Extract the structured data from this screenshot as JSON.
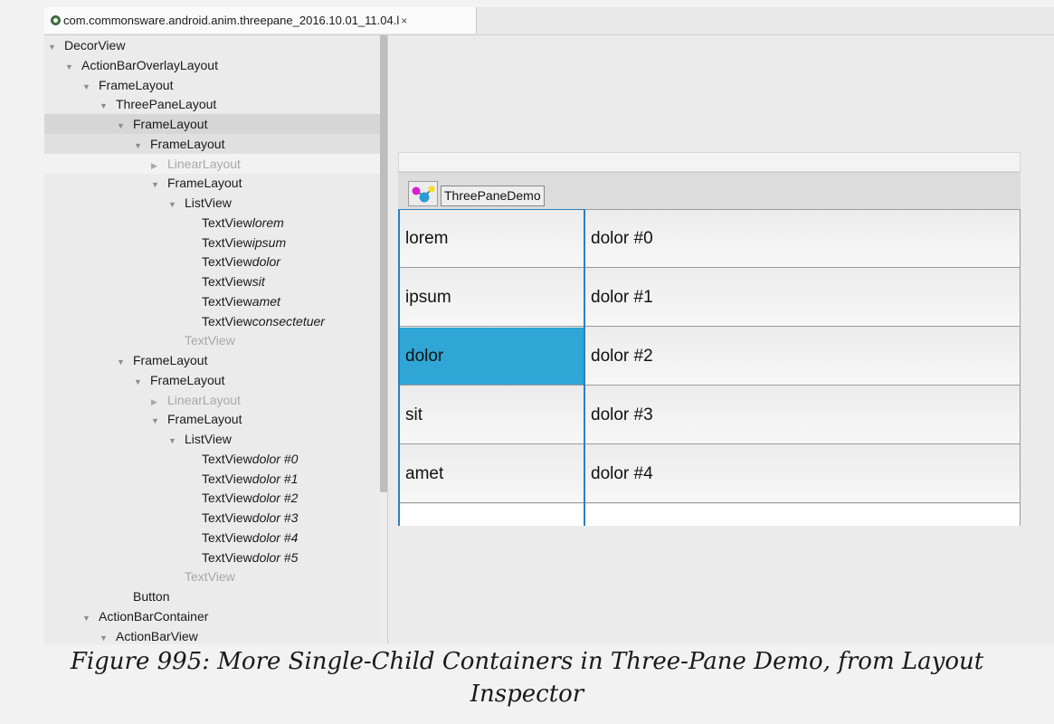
{
  "tab": {
    "title": "com.commonsware.android.anim.threepane_2016.10.01_11.04.l",
    "close": "×"
  },
  "tree": [
    {
      "label": "DecorView",
      "suffix": "",
      "depth": 0,
      "arrow": "expanded",
      "state": "normal"
    },
    {
      "label": "ActionBarOverlayLayout",
      "suffix": "",
      "depth": 1,
      "arrow": "expanded",
      "state": "normal"
    },
    {
      "label": "FrameLayout",
      "suffix": "",
      "depth": 2,
      "arrow": "expanded",
      "state": "normal"
    },
    {
      "label": "ThreePaneLayout",
      "suffix": "",
      "depth": 3,
      "arrow": "expanded",
      "state": "normal"
    },
    {
      "label": "FrameLayout",
      "suffix": "",
      "depth": 4,
      "arrow": "expanded",
      "state": "selected"
    },
    {
      "label": "FrameLayout",
      "suffix": "",
      "depth": 5,
      "arrow": "expanded",
      "state": "hover"
    },
    {
      "label": "LinearLayout",
      "suffix": "",
      "depth": 6,
      "arrow": "collapsed",
      "state": "dim-light"
    },
    {
      "label": "FrameLayout",
      "suffix": "",
      "depth": 6,
      "arrow": "expanded",
      "state": "normal"
    },
    {
      "label": "ListView",
      "suffix": "",
      "depth": 7,
      "arrow": "expanded",
      "state": "normal"
    },
    {
      "label": "TextView",
      "suffix": "lorem",
      "depth": 8,
      "arrow": "none",
      "state": "normal"
    },
    {
      "label": "TextView",
      "suffix": "ipsum",
      "depth": 8,
      "arrow": "none",
      "state": "normal"
    },
    {
      "label": "TextView",
      "suffix": "dolor",
      "depth": 8,
      "arrow": "none",
      "state": "normal"
    },
    {
      "label": "TextView",
      "suffix": "sit",
      "depth": 8,
      "arrow": "none",
      "state": "normal"
    },
    {
      "label": "TextView",
      "suffix": "amet",
      "depth": 8,
      "arrow": "none",
      "state": "normal"
    },
    {
      "label": "TextView",
      "suffix": "consectetuer",
      "depth": 8,
      "arrow": "none",
      "state": "normal"
    },
    {
      "label": "TextView",
      "suffix": "",
      "depth": 7,
      "arrow": "none",
      "state": "dim"
    },
    {
      "label": "FrameLayout",
      "suffix": "",
      "depth": 4,
      "arrow": "expanded",
      "state": "normal"
    },
    {
      "label": "FrameLayout",
      "suffix": "",
      "depth": 5,
      "arrow": "expanded",
      "state": "normal"
    },
    {
      "label": "LinearLayout",
      "suffix": "",
      "depth": 6,
      "arrow": "collapsed",
      "state": "dim"
    },
    {
      "label": "FrameLayout",
      "suffix": "",
      "depth": 6,
      "arrow": "expanded",
      "state": "normal"
    },
    {
      "label": "ListView",
      "suffix": "",
      "depth": 7,
      "arrow": "expanded",
      "state": "normal"
    },
    {
      "label": "TextView",
      "suffix": "dolor #0",
      "depth": 8,
      "arrow": "none",
      "state": "normal"
    },
    {
      "label": "TextView",
      "suffix": "dolor #1",
      "depth": 8,
      "arrow": "none",
      "state": "normal"
    },
    {
      "label": "TextView",
      "suffix": "dolor #2",
      "depth": 8,
      "arrow": "none",
      "state": "normal"
    },
    {
      "label": "TextView",
      "suffix": "dolor #3",
      "depth": 8,
      "arrow": "none",
      "state": "normal"
    },
    {
      "label": "TextView",
      "suffix": "dolor #4",
      "depth": 8,
      "arrow": "none",
      "state": "normal"
    },
    {
      "label": "TextView",
      "suffix": "dolor #5",
      "depth": 8,
      "arrow": "none",
      "state": "normal"
    },
    {
      "label": "TextView",
      "suffix": "",
      "depth": 7,
      "arrow": "none",
      "state": "dim"
    },
    {
      "label": "Button",
      "suffix": "",
      "depth": 4,
      "arrow": "none",
      "state": "normal"
    },
    {
      "label": "ActionBarContainer",
      "suffix": "",
      "depth": 2,
      "arrow": "expanded",
      "state": "normal"
    },
    {
      "label": "ActionBarView",
      "suffix": "",
      "depth": 3,
      "arrow": "expanded",
      "state": "normal"
    }
  ],
  "preview": {
    "app_title": "ThreePaneDemo",
    "left_items": [
      "lorem",
      "ipsum",
      "dolor",
      "sit",
      "amet"
    ],
    "right_items": [
      "dolor #0",
      "dolor #1",
      "dolor #2",
      "dolor #3",
      "dolor #4"
    ],
    "active_left": "dolor",
    "active_color": "#2fa6d6",
    "selection_border_color": "#2e7fc0"
  },
  "caption": {
    "line1": "Figure 995: More Single-Child Containers in Three-Pane Demo, from Layout",
    "line2": "Inspector"
  }
}
